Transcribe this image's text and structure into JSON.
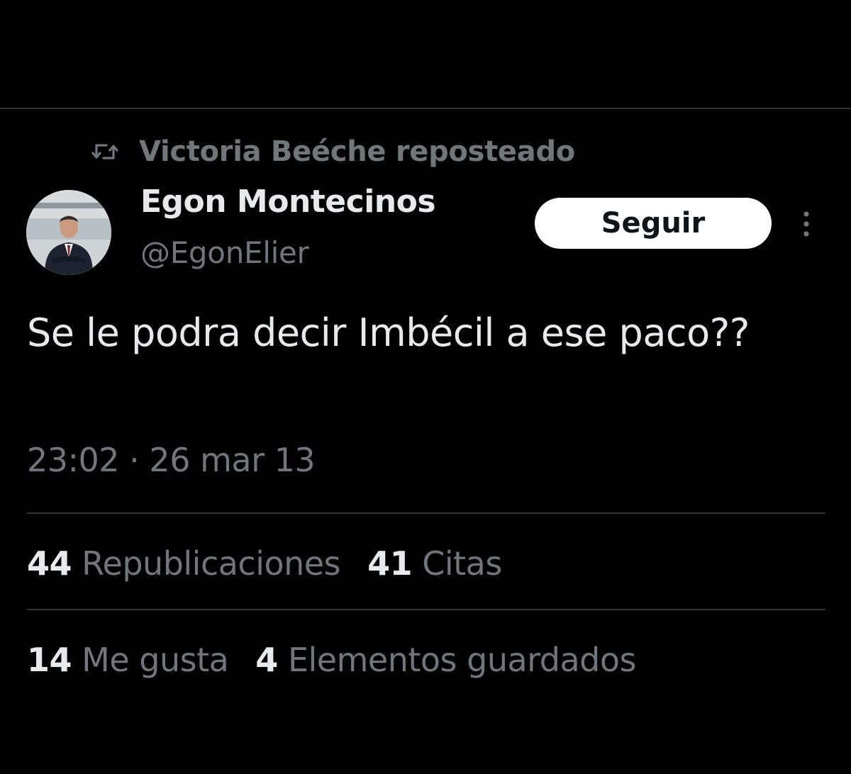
{
  "repost": {
    "icon": "repost-icon",
    "text": "Victoria Beéche reposteado"
  },
  "author": {
    "name": "Egon Montecinos",
    "handle": "@EgonElier"
  },
  "follow_button": {
    "label": "Seguir"
  },
  "more_icon": "more-vertical-icon",
  "tweet": {
    "text": "Se le podra decir Imbécil a ese paco??",
    "timestamp": "23:02 · 26 mar 13"
  },
  "stats": {
    "reposts": {
      "count": "44",
      "label": "Republicaciones"
    },
    "quotes": {
      "count": "41",
      "label": "Citas"
    },
    "likes": {
      "count": "14",
      "label": "Me gusta"
    },
    "bookmarks": {
      "count": "4",
      "label": "Elementos guardados"
    }
  },
  "colors": {
    "background": "#000000",
    "primary_text": "#e7e9ea",
    "secondary_text": "#71767b",
    "divider": "#2f3336",
    "button_bg": "#ffffff",
    "button_text": "#0f1419"
  }
}
